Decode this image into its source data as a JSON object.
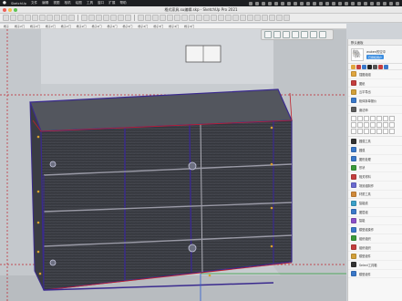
{
  "menubar": {
    "items": [
      "SketchUp",
      "文件",
      "编辑",
      "视图",
      "相机",
      "绘图",
      "工具",
      "窗口",
      "扩展",
      "帮助"
    ]
  },
  "window": {
    "title": "格式家具.su编辑.skp - SketchUp Pro 2021"
  },
  "tags": [
    "杨子",
    "杨子2门",
    "杨子2门",
    "杨子2门",
    "杨子2门",
    "杨子2门",
    "杨子2门",
    "杨子2门",
    "杨子2门",
    "杨子2门",
    "杨子3门",
    "杨子4门",
    "杨子4门"
  ],
  "panel": {
    "header": "默认面板",
    "user_name": "wuken的空中",
    "user_button": "已授权用户",
    "top_items": [
      {
        "label": "插图组组",
        "icon": "folder-icon",
        "color": "#e0a640"
      },
      {
        "label": "图纸",
        "icon": "drawing-icon",
        "color": "#c43e3e"
      },
      {
        "label": "云平导出",
        "icon": "cloud-export-icon",
        "color": "#d2a03a"
      },
      {
        "label": "柜体拆单报价",
        "icon": "quote-icon",
        "color": "#3a78c9"
      },
      {
        "label": "魔法师",
        "icon": "wizard-icon",
        "color": "#5d5d5d"
      }
    ],
    "bottom_items": [
      {
        "label": "圆弧工具",
        "icon": "arc-icon",
        "color": "#333333"
      },
      {
        "label": "圆弧",
        "icon": "arc2-icon",
        "color": "#3a78c9"
      },
      {
        "label": "图形处理",
        "icon": "shape-icon",
        "color": "#3a78c9"
      },
      {
        "label": "形状",
        "icon": "shape2-icon",
        "color": "#3a9a3a"
      },
      {
        "label": "相关材料",
        "icon": "material-icon",
        "color": "#c43e3e"
      },
      {
        "label": "场景组制作",
        "icon": "scene-icon",
        "color": "#6a6ad0"
      },
      {
        "label": "材质工具",
        "icon": "texture-icon",
        "color": "#d08a3a"
      },
      {
        "label": "智能线",
        "icon": "line-icon",
        "color": "#3aa0c8"
      },
      {
        "label": "图层组",
        "icon": "layer-icon",
        "color": "#3a78c9"
      },
      {
        "label": "智能",
        "icon": "smart-icon",
        "color": "#8a4fc8"
      },
      {
        "label": "模型组操作",
        "icon": "model-icon",
        "color": "#3a78c9"
      },
      {
        "label": "组织组织",
        "icon": "org-icon",
        "color": "#3a9a3a"
      },
      {
        "label": "组织组织",
        "icon": "org2-icon",
        "color": "#c43e3e"
      },
      {
        "label": "模型组件",
        "icon": "component-icon",
        "color": "#d2a03a"
      },
      {
        "label": "Select工具箱",
        "icon": "select-icon",
        "color": "#333333"
      },
      {
        "label": "模型组件",
        "icon": "component2-icon",
        "color": "#3a78c9"
      }
    ]
  },
  "colors": {
    "menubar_bg": "#1d1f22",
    "viewport_bg": "#c8ccd0",
    "cabinet_edge": "#3a2a8e",
    "cabinet_body": "#3b3d44",
    "highlight_red": "#c0202a"
  }
}
